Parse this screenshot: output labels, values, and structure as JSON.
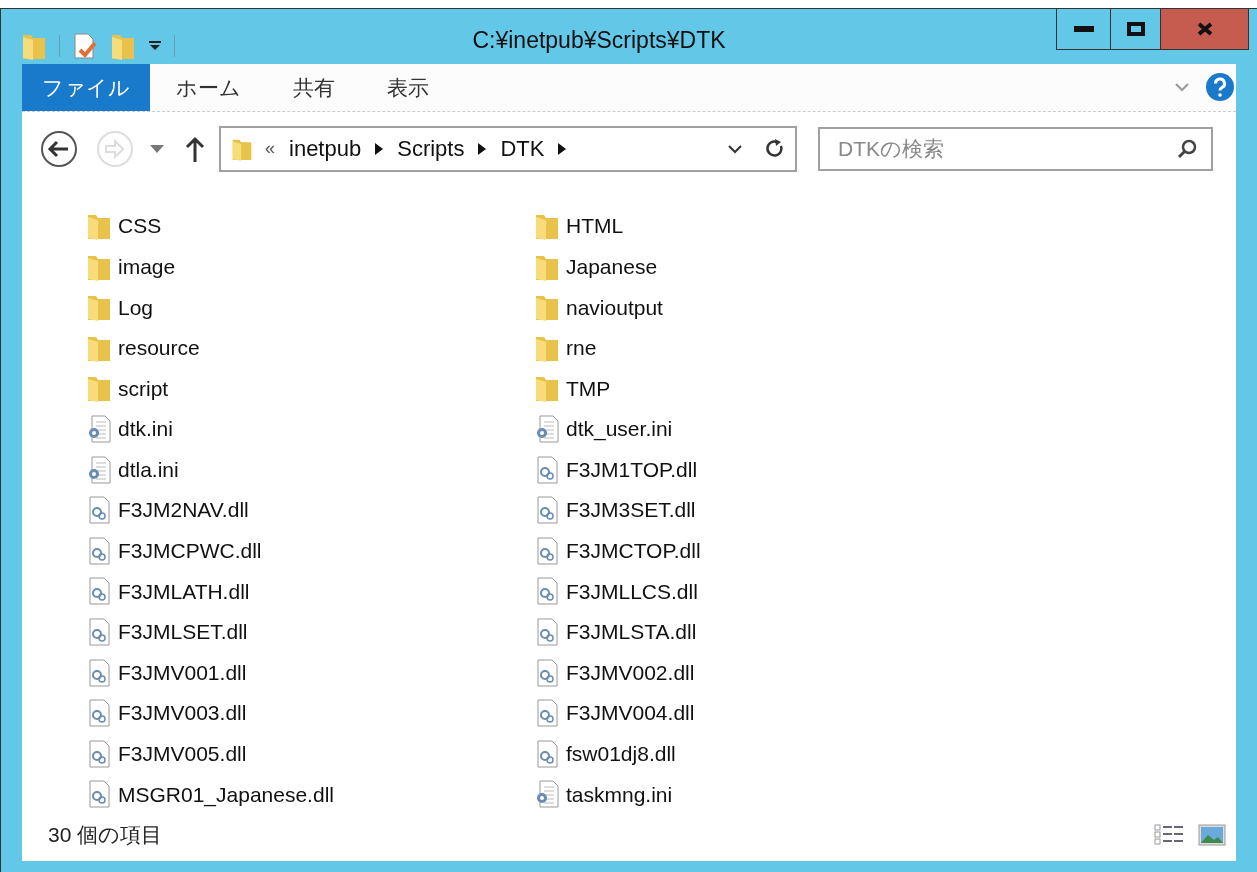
{
  "window": {
    "title": "C:¥inetpub¥Scripts¥DTK"
  },
  "ribbon_tabs": [
    {
      "label": "ファイル",
      "selected": true
    },
    {
      "label": "ホーム",
      "selected": false
    },
    {
      "label": "共有",
      "selected": false
    },
    {
      "label": "表示",
      "selected": false
    }
  ],
  "address_bar": {
    "overflow": "«",
    "segments": [
      "inetpub",
      "Scripts",
      "DTK"
    ]
  },
  "search": {
    "placeholder": "DTKの検索"
  },
  "items": [
    {
      "name": "CSS",
      "kind": "folder"
    },
    {
      "name": "HTML",
      "kind": "folder"
    },
    {
      "name": "image",
      "kind": "folder"
    },
    {
      "name": "Japanese",
      "kind": "folder"
    },
    {
      "name": "Log",
      "kind": "folder"
    },
    {
      "name": "navioutput",
      "kind": "folder"
    },
    {
      "name": "resource",
      "kind": "folder"
    },
    {
      "name": "rne",
      "kind": "folder"
    },
    {
      "name": "script",
      "kind": "folder"
    },
    {
      "name": "TMP",
      "kind": "folder"
    },
    {
      "name": "dtk.ini",
      "kind": "ini"
    },
    {
      "name": "dtk_user.ini",
      "kind": "ini"
    },
    {
      "name": "dtla.ini",
      "kind": "ini"
    },
    {
      "name": "F3JM1TOP.dll",
      "kind": "dll"
    },
    {
      "name": "F3JM2NAV.dll",
      "kind": "dll"
    },
    {
      "name": "F3JM3SET.dll",
      "kind": "dll"
    },
    {
      "name": "F3JMCPWC.dll",
      "kind": "dll"
    },
    {
      "name": "F3JMCTOP.dll",
      "kind": "dll"
    },
    {
      "name": "F3JMLATH.dll",
      "kind": "dll"
    },
    {
      "name": "F3JMLLCS.dll",
      "kind": "dll"
    },
    {
      "name": "F3JMLSET.dll",
      "kind": "dll"
    },
    {
      "name": "F3JMLSTA.dll",
      "kind": "dll"
    },
    {
      "name": "F3JMV001.dll",
      "kind": "dll"
    },
    {
      "name": "F3JMV002.dll",
      "kind": "dll"
    },
    {
      "name": "F3JMV003.dll",
      "kind": "dll"
    },
    {
      "name": "F3JMV004.dll",
      "kind": "dll"
    },
    {
      "name": "F3JMV005.dll",
      "kind": "dll"
    },
    {
      "name": "fsw01dj8.dll",
      "kind": "dll"
    },
    {
      "name": "MSGR01_Japanese.dll",
      "kind": "dll"
    },
    {
      "name": "taskmng.ini",
      "kind": "ini"
    }
  ],
  "status_bar": {
    "item_count": "30 個の項目"
  }
}
